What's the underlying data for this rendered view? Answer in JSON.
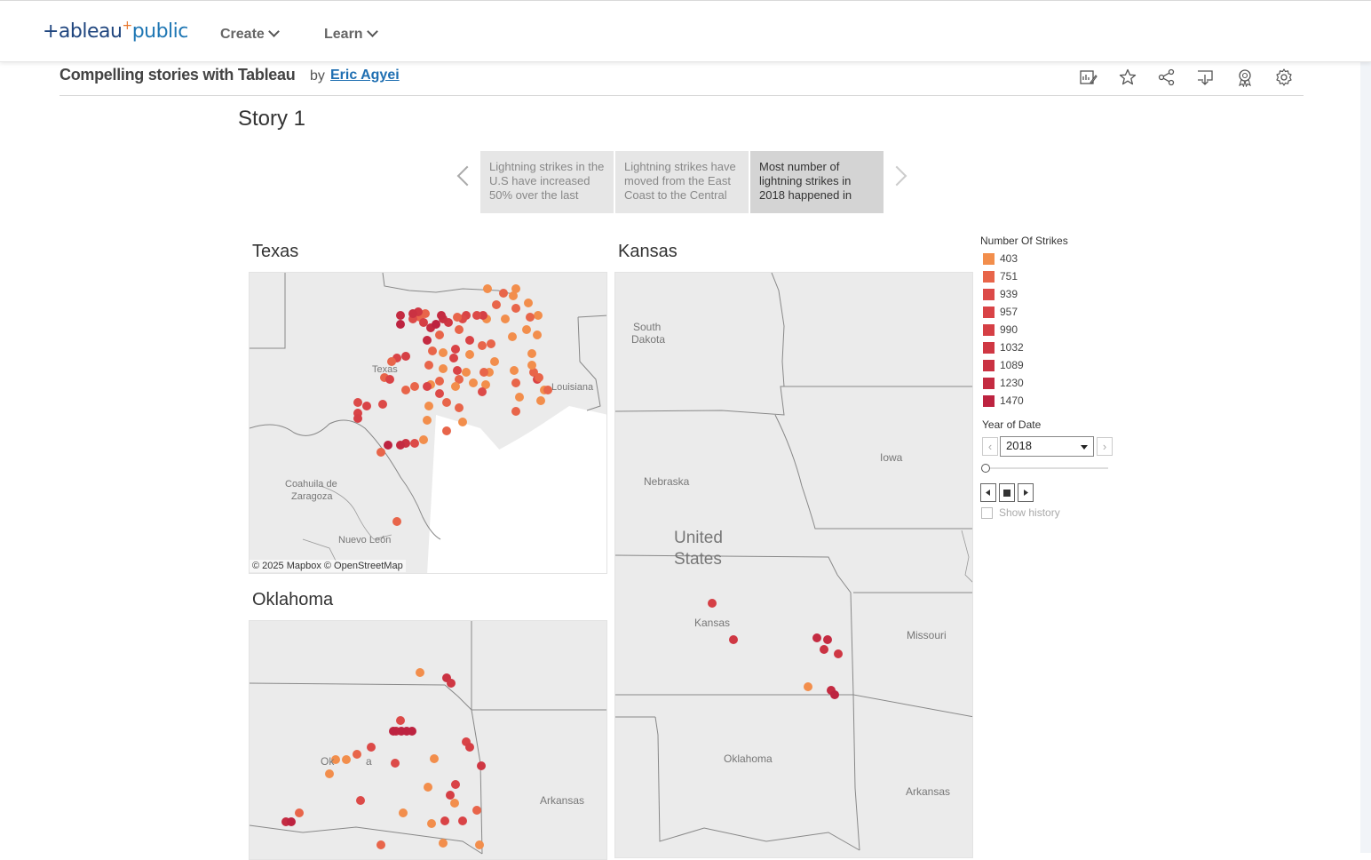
{
  "header": {
    "logo_main": "+ableau",
    "logo_plus": "+",
    "logo_public": "public",
    "nav": [
      {
        "label": "Create"
      },
      {
        "label": "Learn"
      }
    ]
  },
  "viz": {
    "title": "Compelling stories with Tableau",
    "by": "by",
    "author": "Eric Agyei"
  },
  "story": {
    "title": "Story 1",
    "points": [
      {
        "label": "Lightning strikes in the U.S have increased 50% over the last"
      },
      {
        "label": "Lightning strikes have moved from the East Coast to the Central"
      },
      {
        "label": "Most number of lightning strikes in 2018 happened in"
      }
    ],
    "active_index": 2
  },
  "sheets": {
    "texas": "Texas",
    "kansas": "Kansas",
    "oklahoma": "Oklahoma"
  },
  "map_labels": {
    "texas_state": "Texas",
    "louisiana": "Louisiana",
    "coahuila": "Coahuila de",
    "zaragoza": "Zaragoza",
    "nuevo_leon": "Nuevo León",
    "south": "South",
    "dakota": "Dakota",
    "nebraska": "Nebraska",
    "iowa": "Iowa",
    "united": "United",
    "states": "States",
    "kansas_state": "Kansas",
    "missouri": "Missouri",
    "oklahoma_state": "Oklahoma",
    "arkansas": "Arkansas",
    "ok_partial": "Ok",
    "ok_partial2": "a",
    "arkansas2": "Arkansas",
    "attribution": "© 2025 Mapbox  © OpenStreetMap"
  },
  "legend": {
    "title": "Number Of Strikes",
    "items": [
      {
        "label": "403",
        "color": "#f28e4c"
      },
      {
        "label": "751",
        "color": "#e8654a"
      },
      {
        "label": "939",
        "color": "#dc4a48"
      },
      {
        "label": "957",
        "color": "#d94346"
      },
      {
        "label": "990",
        "color": "#d53f45"
      },
      {
        "label": "1032",
        "color": "#cf3743"
      },
      {
        "label": "1089",
        "color": "#ca3242"
      },
      {
        "label": "1230",
        "color": "#c42b41"
      },
      {
        "label": "1470",
        "color": "#bd2340"
      }
    ]
  },
  "year_filter": {
    "title": "Year of Date",
    "selected": "2018",
    "show_history": "Show history"
  }
}
